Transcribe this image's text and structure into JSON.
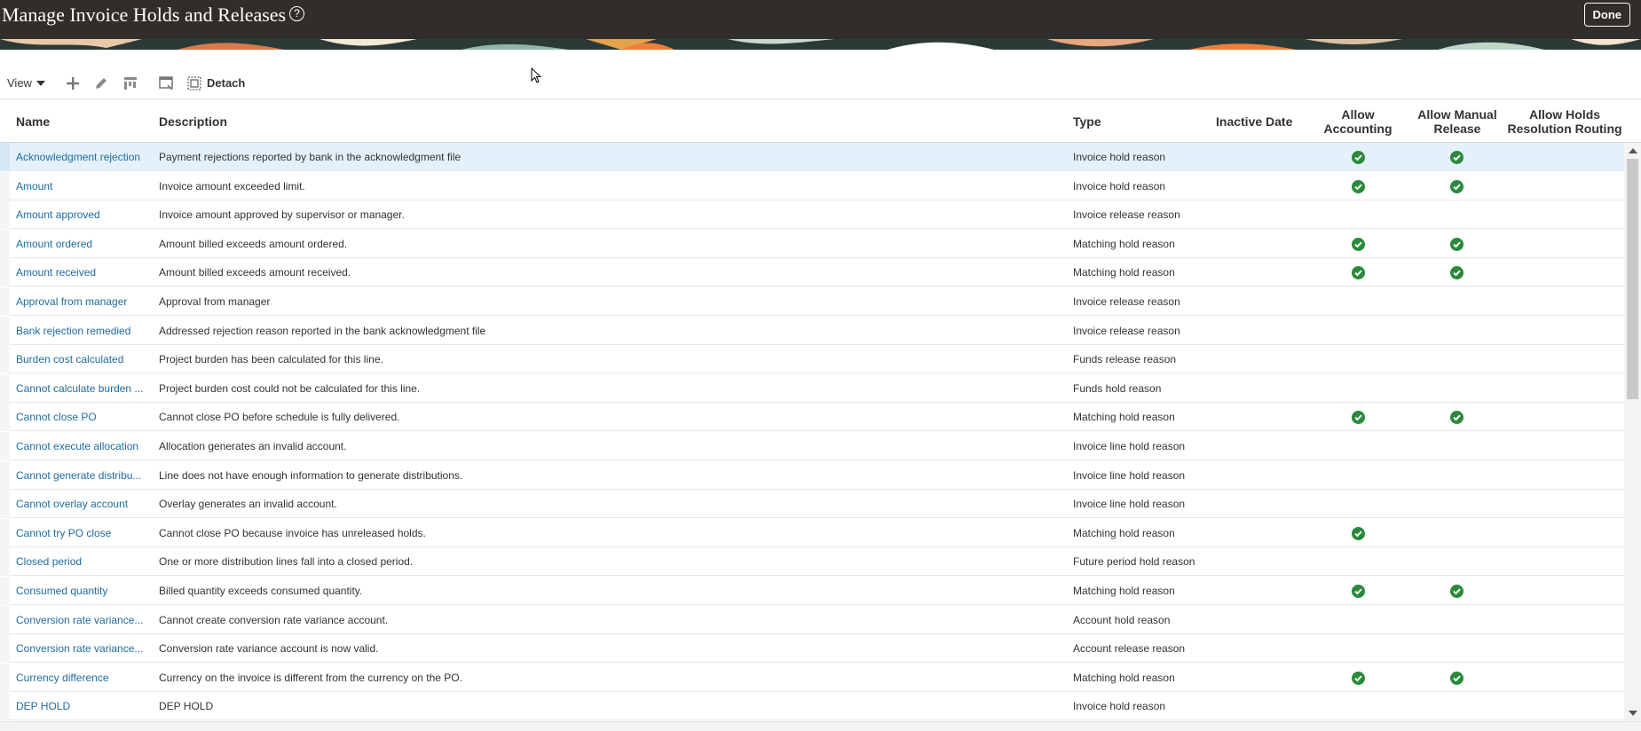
{
  "header": {
    "title": "Manage Invoice Holds and Releases",
    "help_icon": "question-circle-icon",
    "help_glyph": "?",
    "done_label": "Done",
    "bg_color": "#312d2a"
  },
  "toolbar": {
    "view_label": "View",
    "add_icon": "plus-icon",
    "edit_icon": "pencil-icon",
    "format_icon": "column-format-icon",
    "freeze_icon": "freeze-icon",
    "detach_icon": "detach-icon",
    "detach_label": "Detach"
  },
  "table": {
    "columns": {
      "name": "Name",
      "description": "Description",
      "type": "Type",
      "inactive_date": "Inactive Date",
      "allow_accounting_1": "Allow",
      "allow_accounting_2": "Accounting",
      "allow_manual_1": "Allow Manual",
      "allow_manual_2": "Release",
      "allow_holds_1": "Allow Holds",
      "allow_holds_2": "Resolution Routing"
    },
    "check_color": "#2a8a3c",
    "rows": [
      {
        "name": "Acknowledgment rejection",
        "description": "Payment rejections reported by bank in the acknowledgment file",
        "type": "Invoice hold reason",
        "acc": true,
        "man": true,
        "selected": true
      },
      {
        "name": "Amount",
        "description": "Invoice amount exceeded limit.",
        "type": "Invoice hold reason",
        "acc": true,
        "man": true
      },
      {
        "name": "Amount approved",
        "description": "Invoice amount approved by supervisor or manager.",
        "type": "Invoice release reason",
        "acc": false,
        "man": false
      },
      {
        "name": "Amount ordered",
        "description": "Amount billed exceeds amount ordered.",
        "type": "Matching hold reason",
        "acc": true,
        "man": true
      },
      {
        "name": "Amount received",
        "description": "Amount billed exceeds amount received.",
        "type": "Matching hold reason",
        "acc": true,
        "man": true
      },
      {
        "name": "Approval from manager",
        "description": "Approval from manager",
        "type": "Invoice release reason",
        "acc": false,
        "man": false
      },
      {
        "name": "Bank rejection remedied",
        "description": "Addressed rejection reason reported in the bank acknowledgment file",
        "type": "Invoice release reason",
        "acc": false,
        "man": false
      },
      {
        "name": "Burden cost calculated",
        "description": "Project burden has been calculated for this line.",
        "type": "Funds release reason",
        "acc": false,
        "man": false
      },
      {
        "name": "Cannot calculate burden ...",
        "description": "Project burden cost could not be calculated for this line.",
        "type": "Funds hold reason",
        "acc": false,
        "man": false
      },
      {
        "name": "Cannot close PO",
        "description": "Cannot close PO before schedule is fully delivered.",
        "type": "Matching hold reason",
        "acc": true,
        "man": true
      },
      {
        "name": "Cannot execute allocation",
        "description": "Allocation generates an invalid account.",
        "type": "Invoice line hold reason",
        "acc": false,
        "man": false
      },
      {
        "name": "Cannot generate distribu...",
        "description": "Line does not have enough information to generate distributions.",
        "type": "Invoice line hold reason",
        "acc": false,
        "man": false
      },
      {
        "name": "Cannot overlay account",
        "description": "Overlay generates an invalid account.",
        "type": "Invoice line hold reason",
        "acc": false,
        "man": false
      },
      {
        "name": "Cannot try PO close",
        "description": "Cannot close PO because invoice has unreleased holds.",
        "type": "Matching hold reason",
        "acc": true,
        "man": false
      },
      {
        "name": "Closed period",
        "description": "One or more distribution lines fall into a closed period.",
        "type": "Future period hold reason",
        "acc": false,
        "man": false
      },
      {
        "name": "Consumed quantity",
        "description": "Billed quantity exceeds consumed quantity.",
        "type": "Matching hold reason",
        "acc": true,
        "man": true
      },
      {
        "name": "Conversion rate variance...",
        "description": "Cannot create conversion rate variance account.",
        "type": "Account hold reason",
        "acc": false,
        "man": false
      },
      {
        "name": "Conversion rate variance...",
        "description": "Conversion rate variance account is now valid.",
        "type": "Account release reason",
        "acc": false,
        "man": false
      },
      {
        "name": "Currency difference",
        "description": "Currency on the invoice is different from the currency on the PO.",
        "type": "Matching hold reason",
        "acc": true,
        "man": true
      },
      {
        "name": "DEP HOLD",
        "description": "DEP HOLD",
        "type": "Invoice hold reason",
        "acc": false,
        "man": false
      }
    ]
  }
}
